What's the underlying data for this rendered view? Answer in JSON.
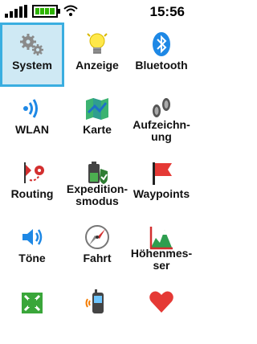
{
  "status": {
    "time": "15:56"
  },
  "items": [
    {
      "label": "System",
      "icon": "gear-icon",
      "selected": true
    },
    {
      "label": "Anzeige",
      "icon": "lightbulb-icon"
    },
    {
      "label": "Bluetooth",
      "icon": "bluetooth-icon"
    },
    {
      "label": "WLAN",
      "icon": "wifi-icon"
    },
    {
      "label": "Karte",
      "icon": "map-icon"
    },
    {
      "label": "Aufzeichn-\nung",
      "icon": "footprints-icon"
    },
    {
      "label": "Routing",
      "icon": "route-pins-icon"
    },
    {
      "label": "Expedition-\nsmodus",
      "icon": "battery-shield-icon"
    },
    {
      "label": "Waypoints",
      "icon": "flag-icon"
    },
    {
      "label": "Töne",
      "icon": "speaker-icon"
    },
    {
      "label": "Fahrt",
      "icon": "compass-icon"
    },
    {
      "label": "Höhenmes-\nser",
      "icon": "mountain-chart-icon"
    },
    {
      "label": "",
      "icon": "geocache-icon"
    },
    {
      "label": "",
      "icon": "handheld-device-icon"
    },
    {
      "label": "",
      "icon": "heart-icon"
    }
  ]
}
